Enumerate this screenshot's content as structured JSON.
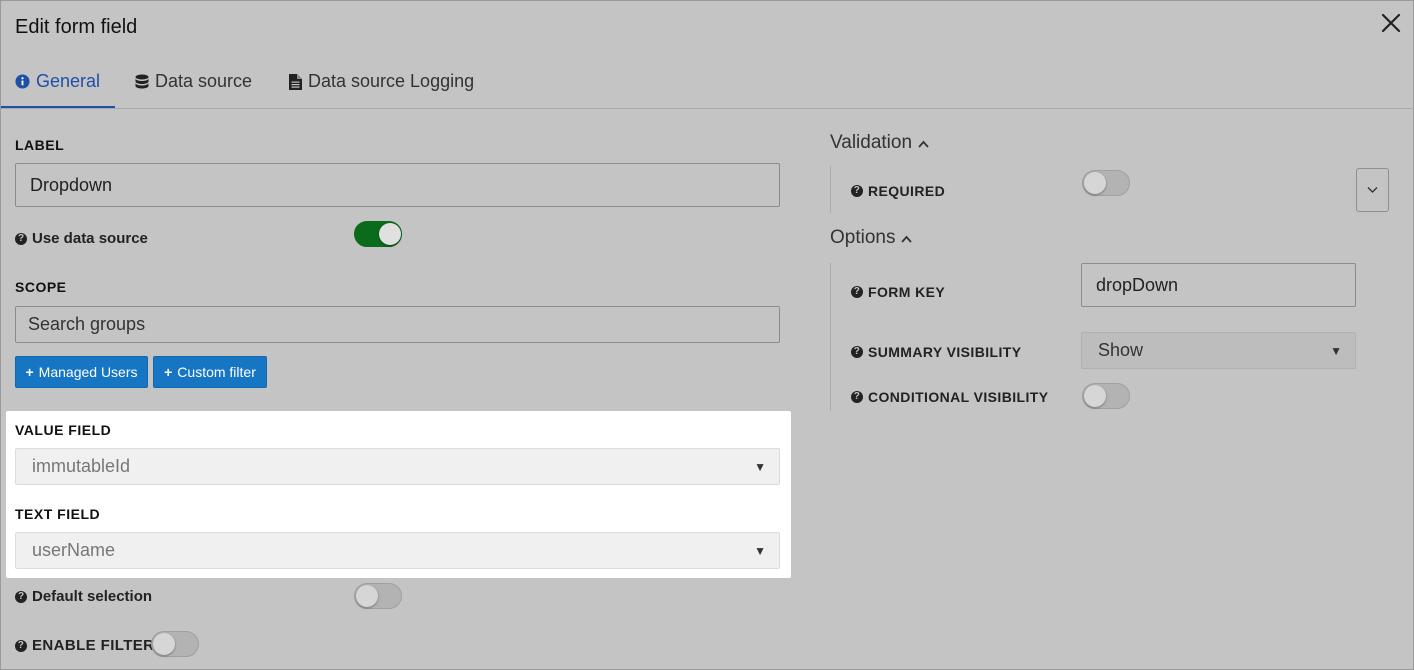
{
  "dialog": {
    "title": "Edit form field"
  },
  "tabs": [
    {
      "label": "General",
      "icon": "info-circle-icon",
      "active": true
    },
    {
      "label": "Data source",
      "icon": "database-icon",
      "active": false
    },
    {
      "label": "Data source Logging",
      "icon": "file-text-icon",
      "active": false
    }
  ],
  "general": {
    "label_heading": "LABEL",
    "label_value": "Dropdown",
    "use_data_source_label": "Use data source",
    "use_data_source_on": true,
    "scope_heading": "SCOPE",
    "scope_placeholder": "Search groups",
    "managed_users_button": "Managed Users",
    "custom_filter_button": "Custom filter",
    "value_field_heading": "VALUE FIELD",
    "value_field_value": "immutableId",
    "text_field_heading": "TEXT FIELD",
    "text_field_value": "userName",
    "default_selection_label": "Default selection",
    "default_selection_on": false,
    "enable_filter_label": "ENABLE FILTER",
    "enable_filter_on": false
  },
  "validation": {
    "heading": "Validation",
    "required_label": "REQUIRED",
    "required_on": false
  },
  "options": {
    "heading": "Options",
    "form_key_label": "FORM KEY",
    "form_key_value": "dropDown",
    "summary_visibility_label": "SUMMARY VISIBILITY",
    "summary_visibility_value": "Show",
    "conditional_visibility_label": "CONDITIONAL VISIBILITY",
    "conditional_visibility_on": false
  },
  "colors": {
    "background": "#c4c4c4",
    "accent_blue": "#1676c4",
    "tab_active": "#1f4fa8",
    "toggle_on": "#0a6b1c"
  }
}
